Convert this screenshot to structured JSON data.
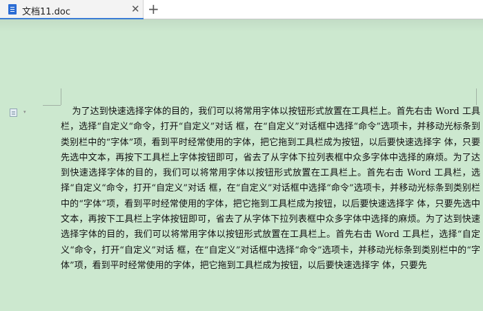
{
  "tab": {
    "title": "文档11.doc",
    "close_glyph": "✕"
  },
  "new_tab_glyph": "+",
  "icons": {
    "doc": "document-icon",
    "paragraph": "paragraph-layout-icon",
    "caret": "▾"
  },
  "document": {
    "body": "为了达到快速选择字体的目的，我们可以将常用字体以按钮形式放置在工具栏上。首先右击 Word 工具栏，选择“自定义“命令，打开“自定义”对话 框，在“自定义”对话框中选择“命令”选项卡，并移动光标条到类别栏中的“字体”项，看到平时经常使用的字体，把它拖到工具栏成为按钮，以后要快速选择字 体，只要先选中文本，再按下工具栏上字体按钮即可，省去了从字体下拉列表框中众多字体中选择的麻烦。为了达到快速选择字体的目的，我们可以将常用字体以按钮形式放置在工具栏上。首先右击 Word 工具栏，选择“自定义“命令，打开“自定义”对话 框，在“自定义”对话框中选择“命令”选项卡，并移动光标条到类别栏中的“字体”项，看到平时经常使用的字体，把它拖到工具栏成为按钮，以后要快速选择字 体，只要先选中文本，再按下工具栏上字体按钮即可，省去了从字体下拉列表框中众多字体中选择的麻烦。为了达到快速选择字体的目的，我们可以将常用字体以按钮形式放置在工具栏上。首先右击 Word 工具栏，选择“自定义“命令，打开“自定义”对话 框，在“自定义”对话框中选择“命令”选项卡，并移动光标条到类别栏中的“字体”项，看到平时经常使用的字体，把它拖到工具栏成为按钮，以后要快速选择字 体，只要先"
  }
}
